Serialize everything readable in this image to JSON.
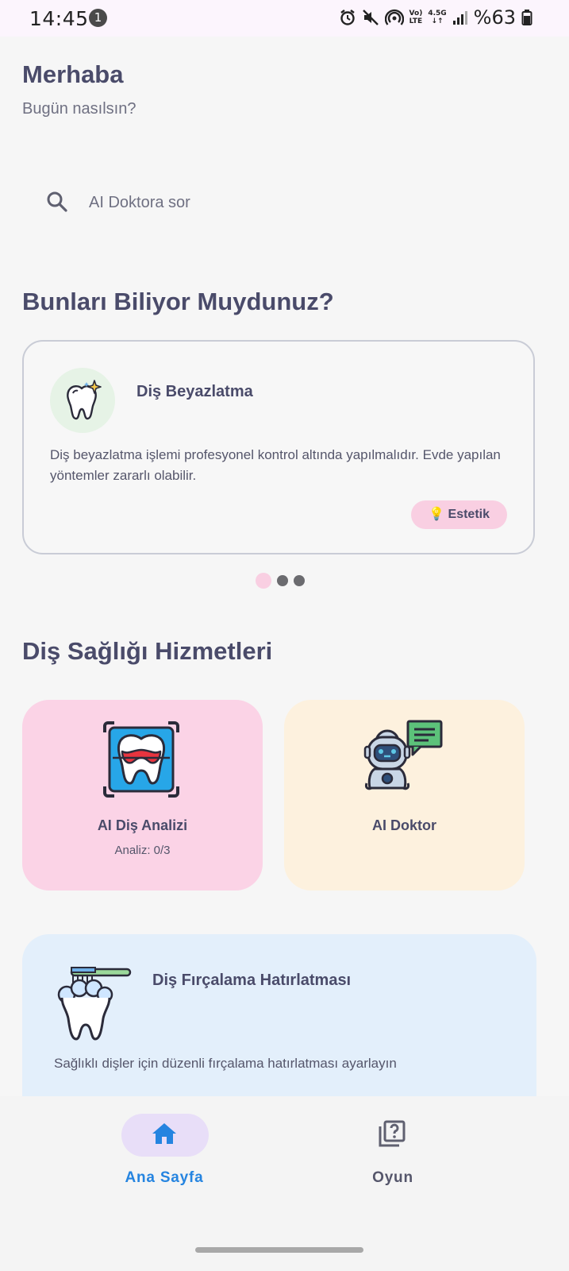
{
  "status_bar": {
    "time": "14:45",
    "notification_count": "1",
    "lte_top": "Vo)",
    "lte_bottom": "LTE",
    "net_top": "4.5G",
    "net_bottom": "↓↑",
    "battery": "%63",
    "icons": [
      "alarm-icon",
      "mute-icon",
      "hotspot-icon",
      "signal-icon",
      "battery-icon"
    ]
  },
  "greeting": {
    "title": "Merhaba",
    "subtitle": "Bugün nasılsın?"
  },
  "search": {
    "placeholder": "AI Doktora sor",
    "value": ""
  },
  "facts_section": {
    "title": "Bunları Biliyor Muydunuz?",
    "card": {
      "icon": "sparkling-tooth-icon",
      "title": "Diş Beyazlatma",
      "body": "Diş beyazlatma işlemi profesyonel kontrol altında yapılmalıdır. Evde yapılan yöntemler zararlı olabilir.",
      "tag": "💡 Estetik"
    },
    "pager": {
      "count": 3,
      "active": 1
    }
  },
  "services_section": {
    "title": "Diş Sağlığı Hizmetleri",
    "items": [
      {
        "title": "AI Diş Analizi",
        "subtitle": "Analiz: 0/3",
        "icon": "tooth-scan-icon",
        "color": "#fbd3e6"
      },
      {
        "title": "AI Doktor",
        "subtitle": "",
        "icon": "robot-chat-icon",
        "color": "#fdf1de"
      }
    ]
  },
  "reminder": {
    "title": "Diş Fırçalama Hatırlatması",
    "body": "Sağlıklı dişler için düzenli fırçalama hatırlatması ayarlayın",
    "icon": "tooth-brushing-icon",
    "color": "#e3effb"
  },
  "bottom_nav": {
    "items": [
      {
        "label": "Ana Sayfa",
        "icon": "home-icon",
        "active": true
      },
      {
        "label": "Oyun",
        "icon": "quiz-icon",
        "active": false
      }
    ]
  },
  "colors": {
    "accent_blue": "#2584e0",
    "title_text": "#4a4b6a",
    "nav_active_pill": "#e8def8",
    "tag_pink": "#f9cfe2"
  }
}
